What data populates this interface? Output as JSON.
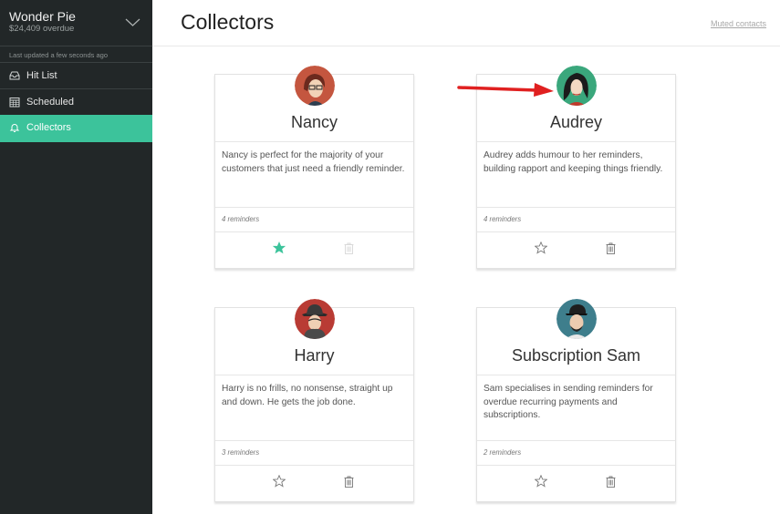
{
  "sidebar": {
    "org_name": "Wonder Pie",
    "org_sub": "$24,409 overdue",
    "updated": "Last updated a few seconds ago",
    "items": [
      {
        "label": "Hit List",
        "icon": "inbox-icon",
        "active": false
      },
      {
        "label": "Scheduled",
        "icon": "calendar-icon",
        "active": false
      },
      {
        "label": "Collectors",
        "icon": "bell-icon",
        "active": true
      }
    ]
  },
  "header": {
    "title": "Collectors",
    "muted_link": "Muted contacts"
  },
  "collectors": [
    {
      "name": "Nancy",
      "description": "Nancy is perfect for the majority of your customers that just need a friendly reminder.",
      "reminders": "4 reminders",
      "starred": true,
      "avatar_color": "#c4563f"
    },
    {
      "name": "Audrey",
      "description": "Audrey adds humour to her reminders, building rapport and keeping things friendly.",
      "reminders": "4 reminders",
      "starred": false,
      "avatar_color": "#3aa77c"
    },
    {
      "name": "Harry",
      "description": "Harry is no frills, no nonsense, straight up and down. He gets the job done.",
      "reminders": "3 reminders",
      "starred": false,
      "avatar_color": "#b93b34"
    },
    {
      "name": "Subscription Sam",
      "description": "Sam specialises in sending reminders for overdue recurring payments and subscriptions.",
      "reminders": "2 reminders",
      "starred": false,
      "avatar_color": "#3e7e8c"
    }
  ],
  "colors": {
    "sidebar_bg": "#222728",
    "accent": "#3cc39b",
    "annotation_arrow": "#e02020"
  }
}
